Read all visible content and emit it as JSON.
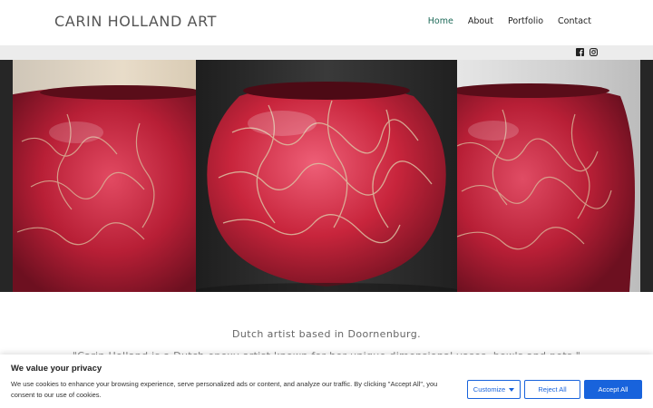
{
  "header": {
    "site_title": "CARIN HOLLAND ART",
    "nav": [
      {
        "label": "Home",
        "active": true
      },
      {
        "label": "About",
        "active": false
      },
      {
        "label": "Portfolio",
        "active": false
      },
      {
        "label": "Contact",
        "active": false
      }
    ]
  },
  "social": {
    "icons": [
      "facebook-icon",
      "instagram-icon"
    ]
  },
  "main": {
    "intro": "Dutch artist based in Doornenburg.",
    "quote": "\"Carin Holland is a Dutch epoxy artist known for her unique dimensional vases, bowls and pots.\""
  },
  "cookie_banner": {
    "title": "We value your privacy",
    "text": "We use cookies to enhance your browsing experience, serve personalized ads or content, and analyze our traffic. By clicking \"Accept All\", you consent to our use of cookies.",
    "customize_label": "Customize",
    "reject_label": "Reject All",
    "accept_label": "Accept All"
  },
  "colors": {
    "accent": "#1863dc",
    "nav_active": "#1f6b5a",
    "vase_red": "#c8253c"
  }
}
